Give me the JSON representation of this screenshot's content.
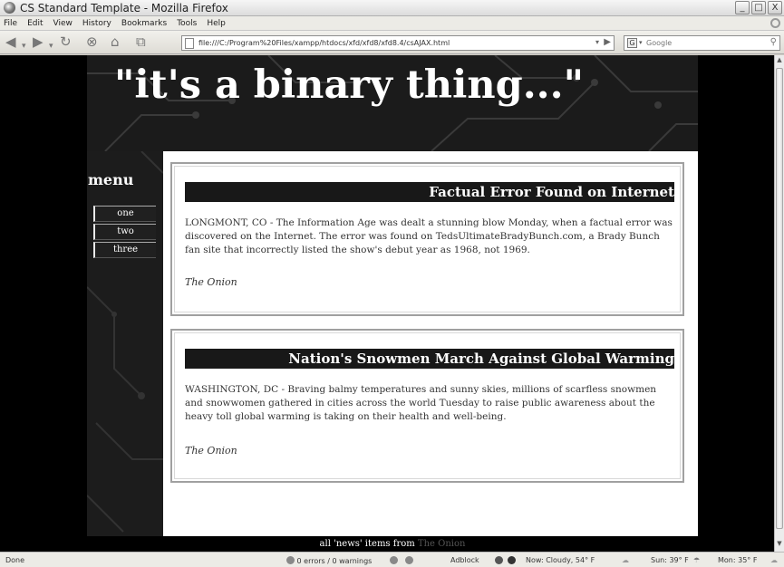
{
  "window": {
    "title": "CS Standard Template - Mozilla Firefox",
    "buttons": [
      "_",
      "□",
      "X"
    ]
  },
  "menubar": [
    "File",
    "Edit",
    "View",
    "History",
    "Bookmarks",
    "Tools",
    "Help"
  ],
  "navbar": {
    "url": "file:///C:/Program%20Files/xampp/htdocs/xfd/xfd8/xfd8.4/csAJAX.html",
    "search_placeholder": "Google",
    "search_engine_icon": "G"
  },
  "page": {
    "banner_title": "\"it's a binary thing...\"",
    "menu_title": "menu",
    "nav": [
      "one",
      "two",
      "three"
    ],
    "articles": [
      {
        "headline": "Factual Error Found on Internet",
        "body": "LONGMONT, CO - The Information Age was dealt a stunning blow Monday, when a factual error was discovered on the Internet. The error was found on TedsUltimateBradyBunch.com, a Brady Bunch fan site that incorrectly listed the show's debut year as 1968, not 1969.",
        "source": "The Onion"
      },
      {
        "headline": "Nation's Snowmen March Against Global Warming",
        "body": "WASHINGTON, DC - Braving balmy temperatures and sunny skies, millions of scarfless snowmen and snowwomen gathered in cities across the world Tuesday to raise public awareness about the heavy toll global warming is taking on their health and well-being.",
        "source": "The Onion"
      }
    ],
    "footer_text": "all 'news' items from",
    "footer_link": "The Onion"
  },
  "statusbar": {
    "status": "Done",
    "errors": "0 errors / 0 warnings",
    "adblock": "Adblock",
    "weather_now": "Now: Cloudy, 54° F",
    "weather_sun": "Sun: 39° F",
    "weather_mon": "Mon: 35° F"
  }
}
